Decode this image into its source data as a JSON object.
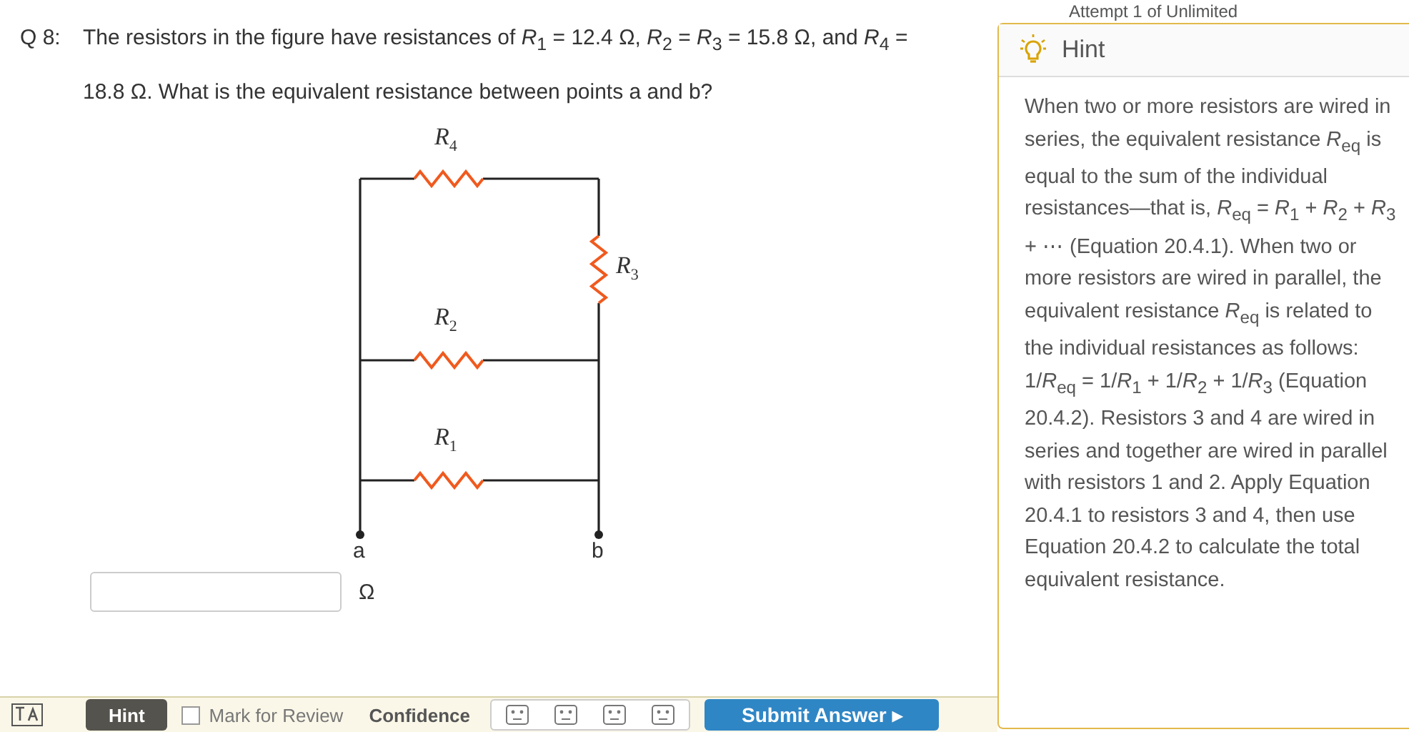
{
  "question": {
    "number": "Q 8:",
    "text": "The resistors in the figure have resistances of *R*$_{1}$ = 12.4 Ω, *R*$_{2}$ = *R*$_{3}$ = 15.8 Ω, and *R*$_{4}$ = 18.8 Ω. What is the equivalent resistance between points a and b?"
  },
  "figure": {
    "resistors": [
      {
        "label": "R$_{4}$"
      },
      {
        "label": "R$_{3}$"
      },
      {
        "label": "R$_{2}$"
      },
      {
        "label": "R$_{1}$"
      }
    ],
    "terminals": [
      "a",
      "b"
    ]
  },
  "answer": {
    "unit": "Ω"
  },
  "toolbar": {
    "hint_button": "Hint",
    "mark_for_review": {
      "label": "Mark for Review",
      "checked": false
    },
    "confidence_label": "Confidence",
    "submit_button": "Submit Answer ▸"
  },
  "attempt": "Attempt 1 of Unlimited",
  "hint": {
    "title": "Hint",
    "text": "When two or more resistors are wired in series, the equivalent resistance *R*$_{eq}$ is equal to the sum of the individual resistances—that is, *R*$_{eq}$ = *R*$_{1}$ + *R*$_{2}$ + *R*$_{3}$ + ⋯ (Equation 20.4.1). When two or more resistors are wired in parallel, the equivalent resistance *R*$_{eq}$ is related to the individual resistances as follows: 1/*R*$_{eq}$ = 1/*R*$_{1}$ + 1/*R*$_{2}$ + 1/*R*$_{3}$ (Equation 20.4.2). Resistors 3 and 4 are wired in series and together are wired in parallel with resistors 1 and 2. Apply Equation 20.4.1 to resistors 3 and 4, then use Equation 20.4.2 to calculate the total equivalent resistance."
  }
}
